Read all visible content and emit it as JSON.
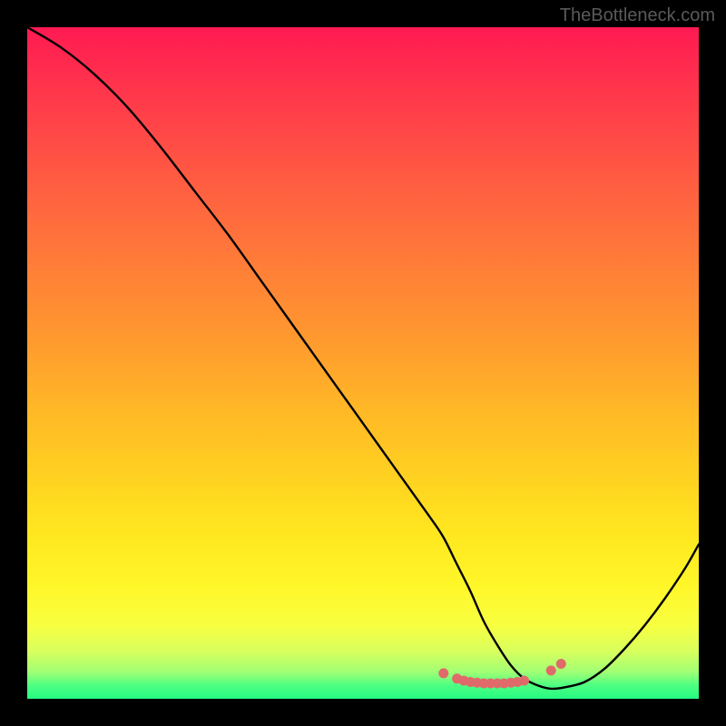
{
  "watermark": "TheBottleneck.com",
  "chart_data": {
    "type": "line",
    "title": "",
    "xlabel": "",
    "ylabel": "",
    "xlim": [
      0,
      100
    ],
    "ylim": [
      0,
      100
    ],
    "series": [
      {
        "name": "curve",
        "x": [
          0,
          5,
          10,
          15,
          20,
          25,
          30,
          35,
          40,
          45,
          50,
          55,
          60,
          62,
          64,
          66,
          68,
          70,
          72,
          74,
          76,
          78,
          80,
          83,
          86,
          89,
          92,
          95,
          98,
          100
        ],
        "values": [
          100,
          97,
          93,
          88,
          82,
          75.5,
          69,
          62,
          55,
          48,
          41,
          34,
          27,
          24,
          20,
          16,
          11.5,
          8,
          5,
          3,
          2,
          1.5,
          1.7,
          2.5,
          4.5,
          7.5,
          11,
          15,
          19.5,
          23
        ]
      }
    ],
    "markers": {
      "name": "highlight-dots",
      "x": [
        62,
        64,
        65,
        66,
        67,
        68,
        69,
        70,
        71,
        72,
        73,
        74,
        78,
        79.5
      ],
      "values": [
        3.8,
        3,
        2.7,
        2.5,
        2.4,
        2.3,
        2.3,
        2.3,
        2.3,
        2.4,
        2.5,
        2.7,
        4.2,
        5.2
      ],
      "color": "#e06a6a",
      "size": 5.5
    },
    "background": "rainbow-vertical-gradient"
  }
}
